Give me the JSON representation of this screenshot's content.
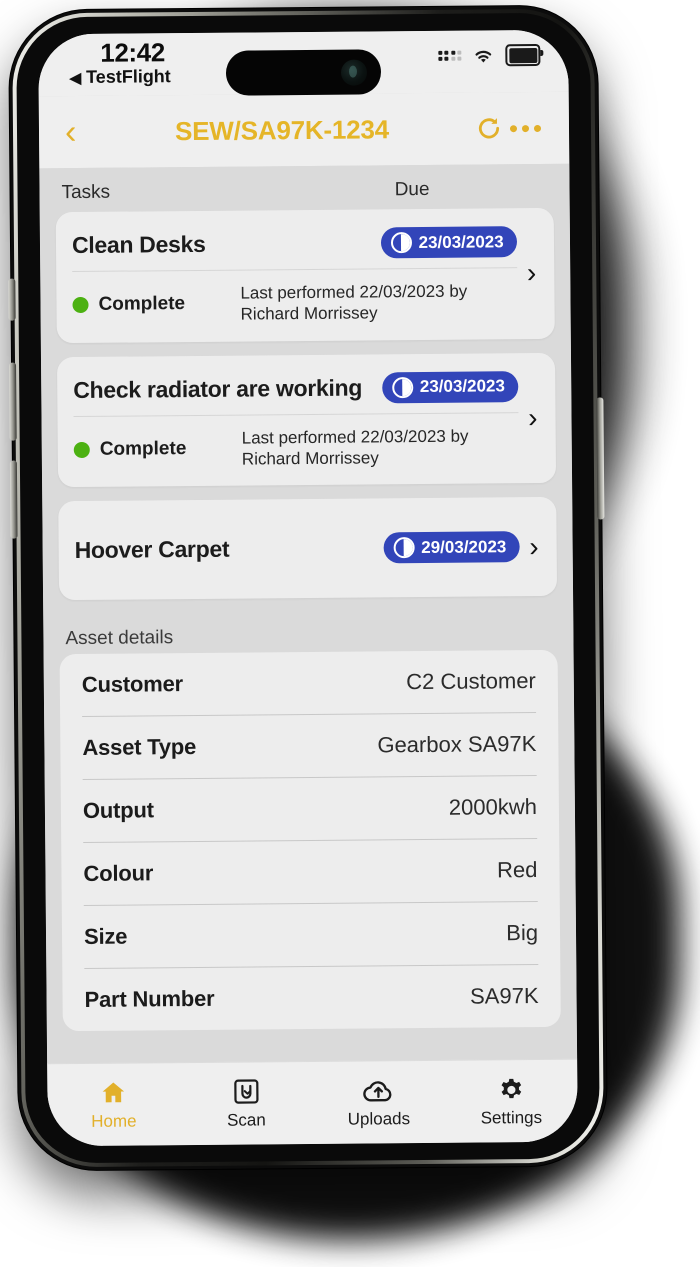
{
  "status_bar": {
    "time": "12:42",
    "back_app": "TestFlight",
    "back_arrow": "◀",
    "signal_icon": "cellular-signal-icon",
    "wifi_icon": "wifi-icon",
    "battery_icon": "battery-icon"
  },
  "nav": {
    "back_icon": "‹",
    "title": "SEW/SA97K-1234",
    "refresh_icon": "refresh-icon",
    "more_icon": "more-options-icon"
  },
  "tasks_section": {
    "header_left": "Tasks",
    "header_right": "Due",
    "chevron": "›",
    "items": [
      {
        "title": "Clean Desks",
        "due": "23/03/2023",
        "due_icon": "clock-icon",
        "status": "Complete",
        "status_color": "#4cb112",
        "last_performed": "Last performed 22/03/2023 by Richard Morrissey",
        "has_status_row": true
      },
      {
        "title": "Check radiator are working",
        "due": "23/03/2023",
        "due_icon": "clock-icon",
        "status": "Complete",
        "status_color": "#4cb112",
        "last_performed": "Last performed 22/03/2023 by Richard Morrissey",
        "has_status_row": true
      },
      {
        "title": "Hoover Carpet",
        "due": "29/03/2023",
        "due_icon": "clock-icon",
        "status": "",
        "last_performed": "",
        "has_status_row": false
      }
    ]
  },
  "asset_section": {
    "header": "Asset details",
    "rows": [
      {
        "key": "Customer",
        "value": "C2 Customer"
      },
      {
        "key": "Asset Type",
        "value": "Gearbox SA97K"
      },
      {
        "key": "Output",
        "value": "2000kwh"
      },
      {
        "key": "Colour",
        "value": "Red"
      },
      {
        "key": "Size",
        "value": "Big"
      },
      {
        "key": "Part Number",
        "value": "SA97K"
      }
    ]
  },
  "tab_bar": {
    "tabs": [
      {
        "label": "Home",
        "icon": "home-icon",
        "active": true
      },
      {
        "label": "Scan",
        "icon": "scan-icon",
        "active": false
      },
      {
        "label": "Uploads",
        "icon": "cloud-upload-icon",
        "active": false
      },
      {
        "label": "Settings",
        "icon": "gear-icon",
        "active": false
      }
    ]
  },
  "colors": {
    "accent_gold": "#e2b02a",
    "badge_blue": "#3245b9",
    "status_green": "#4cb112",
    "page_bg": "#dadada",
    "card_bg": "#ededed",
    "chrome_bg": "#efefef"
  }
}
